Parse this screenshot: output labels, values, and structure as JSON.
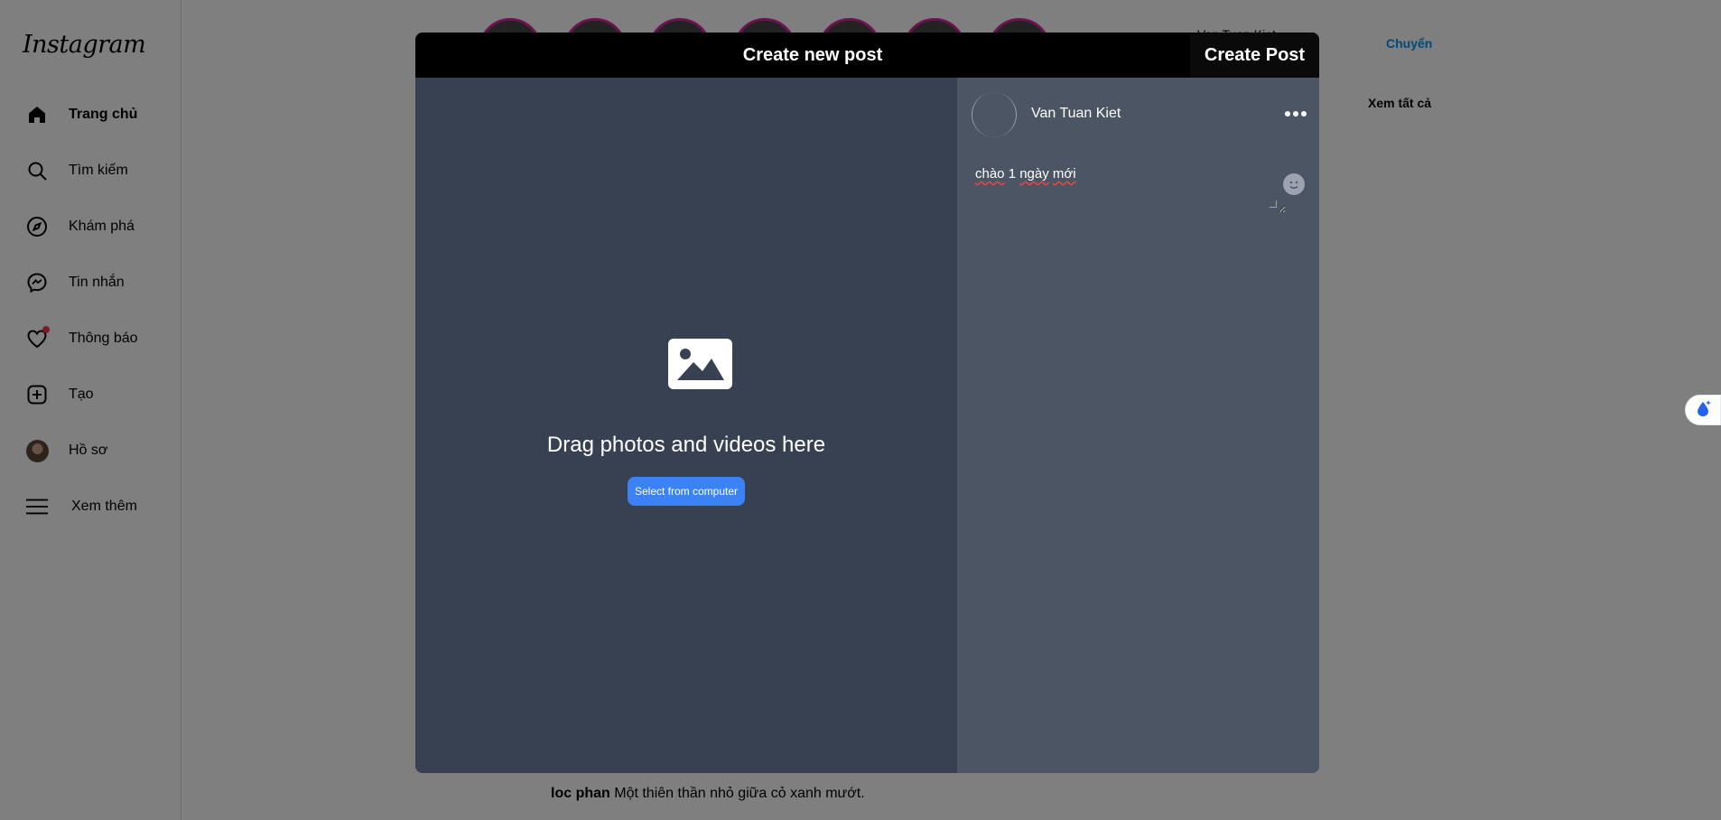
{
  "sidebar": {
    "logo": "Instagram",
    "items": [
      {
        "label": "Trang chủ",
        "icon": "home-icon"
      },
      {
        "label": "Tìm kiếm",
        "icon": "search-icon"
      },
      {
        "label": "Khám phá",
        "icon": "compass-icon"
      },
      {
        "label": "Tin nhắn",
        "icon": "messenger-icon"
      },
      {
        "label": "Thông báo",
        "icon": "heart-icon"
      },
      {
        "label": "Tạo",
        "icon": "plus-square-icon"
      },
      {
        "label": "Hồ sơ",
        "icon": "avatar"
      },
      {
        "label": "Xem thêm",
        "icon": "menu-icon"
      }
    ]
  },
  "background": {
    "right_user": "Van Tuan Kiet",
    "switch_link": "Chuyển",
    "see_all": "Xem tất cả",
    "caption_user": "loc phan",
    "caption_text": "Một thiên thần nhỏ giữa cỏ xanh mướt."
  },
  "modal": {
    "title": "Create new post",
    "create_button": "Create Post",
    "drag_text": "Drag photos and videos here",
    "select_button": "Select from computer",
    "username": "Van Tuan Kiet",
    "caption_word_1": "chào",
    "caption_word_2": "1",
    "caption_word_3": "ngày",
    "caption_word_4": "mới"
  },
  "colors": {
    "accent": "#3b82f6",
    "link": "#0095f6",
    "left_pane": "#374151",
    "right_pane": "#4b5563"
  }
}
